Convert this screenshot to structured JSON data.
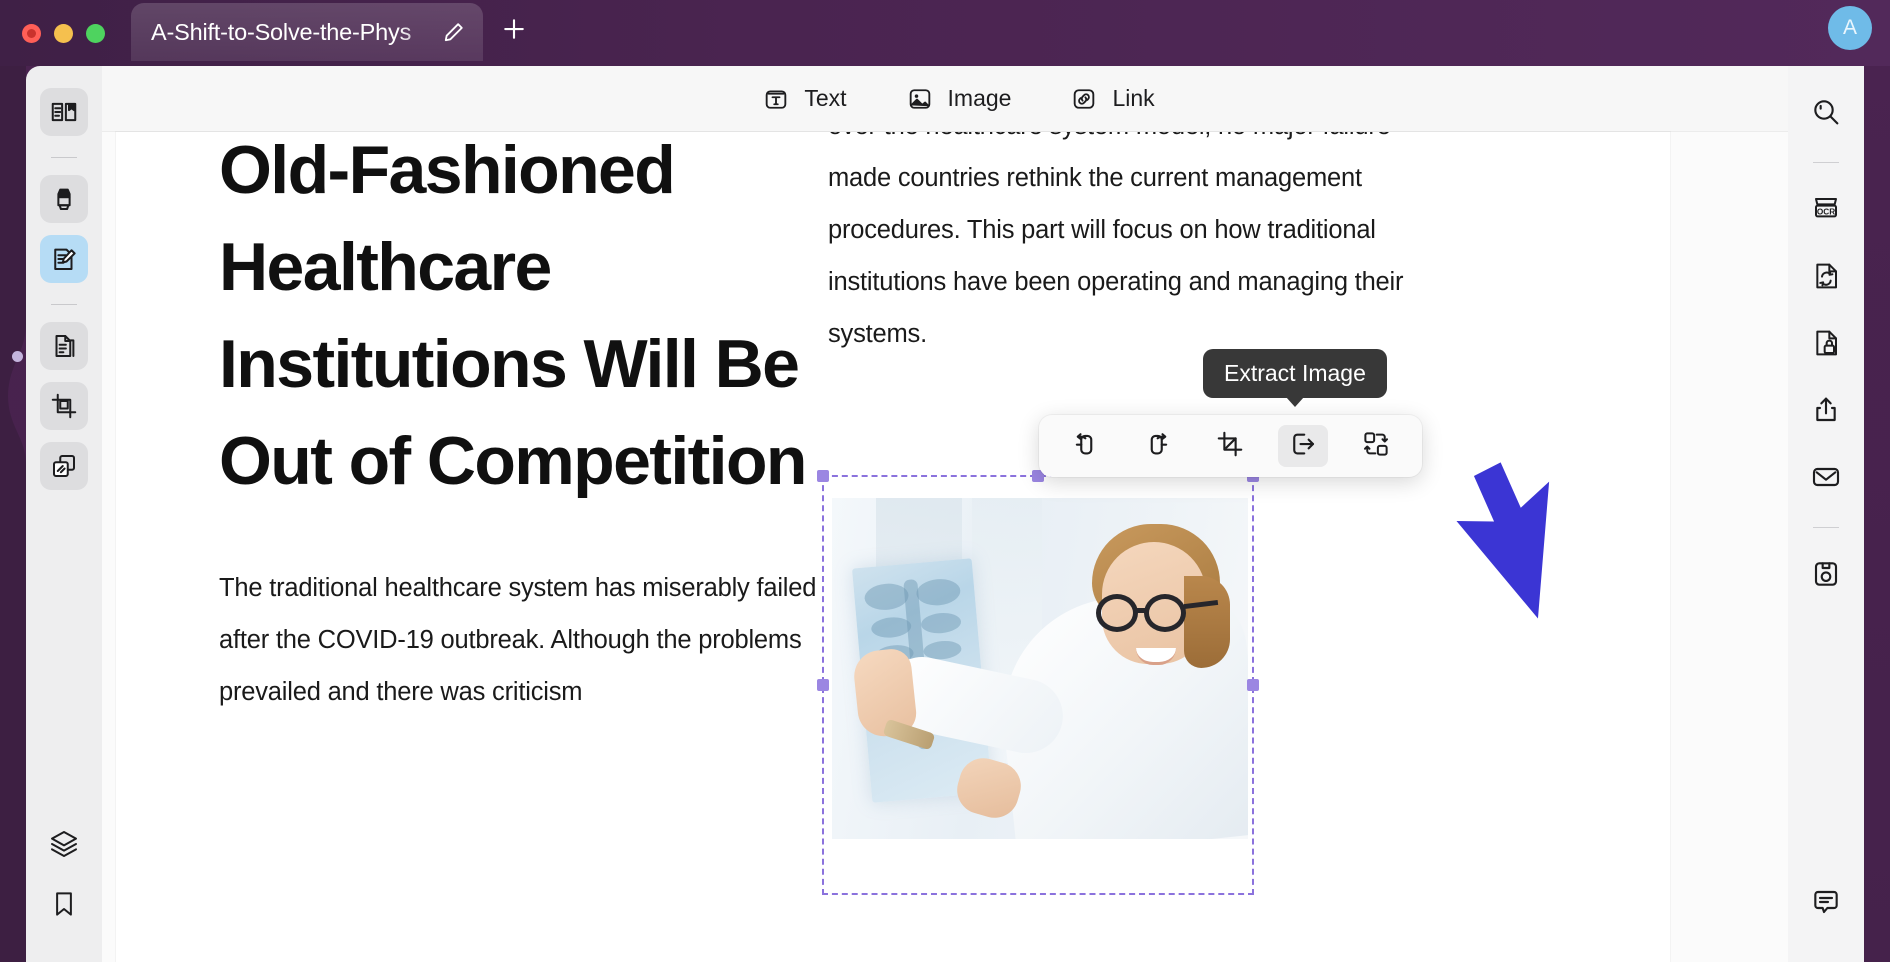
{
  "window": {
    "traffic_lights": [
      "close",
      "minimize",
      "maximize"
    ],
    "tab_title": "A-Shift-to-Solve-the-Phys",
    "new_tab_label": "+",
    "avatar_initial": "A",
    "accent_purple": "#4a2450",
    "avatar_color": "#6fbbe8"
  },
  "toolbar": {
    "items": [
      {
        "label": "Text",
        "icon": "text-box-icon"
      },
      {
        "label": "Image",
        "icon": "image-icon"
      },
      {
        "label": "Link",
        "icon": "link-icon"
      }
    ]
  },
  "left_rail": {
    "items": [
      {
        "name": "reader-mode",
        "icon": "book-bookmark-icon",
        "state": "chip"
      },
      {
        "name": "highlighter",
        "icon": "highlighter-pen-icon",
        "state": "chip"
      },
      {
        "name": "edit-content",
        "icon": "document-pencil-icon",
        "state": "active"
      },
      {
        "name": "organize-pages",
        "icon": "page-stack-icon",
        "state": "chip"
      },
      {
        "name": "crop-page",
        "icon": "crop-page-icon",
        "state": "chip"
      },
      {
        "name": "compare-files",
        "icon": "duplicate-pages-icon",
        "state": "chip"
      },
      {
        "name": "layers",
        "icon": "layers-icon",
        "state": "plain"
      },
      {
        "name": "bookmarks",
        "icon": "bookmark-icon",
        "state": "plain"
      }
    ]
  },
  "right_rail": {
    "items": [
      {
        "name": "search",
        "icon": "search-icon"
      },
      {
        "name": "ocr",
        "icon": "ocr-icon",
        "label": "OCR"
      },
      {
        "name": "convert",
        "icon": "file-convert-icon"
      },
      {
        "name": "protect",
        "icon": "file-lock-icon"
      },
      {
        "name": "share",
        "icon": "share-upload-icon"
      },
      {
        "name": "email",
        "icon": "envelope-icon"
      },
      {
        "name": "save",
        "icon": "floppy-save-icon"
      },
      {
        "name": "comments",
        "icon": "comment-icon"
      }
    ]
  },
  "document": {
    "headline": "Old-Fashioned Healthcare Institutions Will Be Out of Competition",
    "left_paragraph": "The traditional healthcare system has miserably failed after the COVID-19 outbreak. Although the problems prevailed and there was criticism",
    "right_paragraph": "over the healthcare system model; no major failure made countries rethink the current management procedures. This part will focus on how traditional institutions have been operating and managing their systems."
  },
  "image_toolbar": {
    "buttons": [
      {
        "name": "rotate-left",
        "icon": "rotate-left-icon",
        "selected": false
      },
      {
        "name": "rotate-right",
        "icon": "rotate-right-icon",
        "selected": false
      },
      {
        "name": "crop-image",
        "icon": "crop-icon",
        "selected": false
      },
      {
        "name": "extract-image",
        "icon": "extract-export-icon",
        "selected": true
      },
      {
        "name": "replace-image",
        "icon": "replace-swap-icon",
        "selected": false
      }
    ],
    "tooltip": "Extract Image"
  },
  "selection": {
    "handle_color": "#9b86e2",
    "border_color": "#8b72dd",
    "handles": [
      "top-left",
      "top-middle",
      "top-right",
      "middle-left",
      "middle-right"
    ]
  },
  "photo": {
    "alt": "Female doctor in white coat holding a chest x-ray film and smiling at camera"
  }
}
